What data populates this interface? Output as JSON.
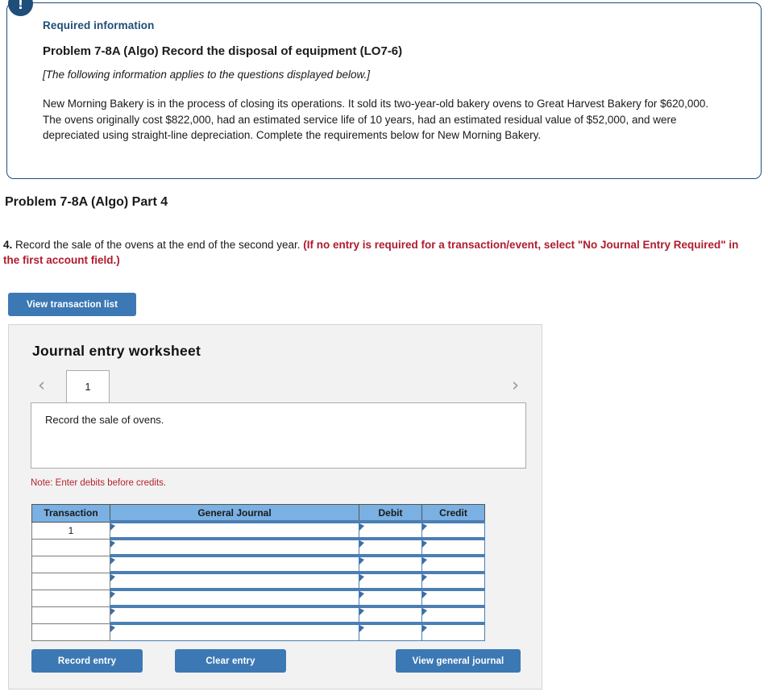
{
  "alert": {
    "icon": "exclamation-icon",
    "glyph": "!"
  },
  "info_box": {
    "required_label": "Required information",
    "problem_title": "Problem 7-8A (Algo) Record the disposal of equipment (LO7-6)",
    "applies_note": "[The following information applies to the questions displayed below.]",
    "body": "New Morning Bakery is in the process of closing its operations. It sold its two-year-old bakery ovens to Great Harvest Bakery for $620,000. The ovens originally cost $822,000, had an estimated service life of 10 years, had an estimated residual value of $52,000, and were depreciated using straight-line depreciation. Complete the requirements below for New Morning Bakery."
  },
  "part": {
    "heading": "Problem 7-8A (Algo) Part 4",
    "question_number": "4.",
    "question_text": " Record the sale of the ovens at the end of the second year. ",
    "question_red": "(If no entry is required for a transaction/event, select \"No Journal Entry Required\" in the first account field.)"
  },
  "buttons": {
    "view_transaction_list": "View transaction list",
    "record_entry": "Record entry",
    "clear_entry": "Clear entry",
    "view_general_journal": "View general journal"
  },
  "worksheet": {
    "title": "Journal entry worksheet",
    "prev_icon": "chevron-left-icon",
    "next_icon": "chevron-right-icon",
    "prev_glyph": "‹",
    "next_glyph": "›",
    "tabs": [
      {
        "label": "1",
        "active": true
      }
    ],
    "description": "Record the sale of ovens.",
    "note": "Note: Enter debits before credits.",
    "table": {
      "headers": [
        "Transaction",
        "General Journal",
        "Debit",
        "Credit"
      ],
      "rows": [
        {
          "transaction": "1",
          "general_journal": "",
          "debit": "",
          "credit": ""
        },
        {
          "transaction": "",
          "general_journal": "",
          "debit": "",
          "credit": ""
        },
        {
          "transaction": "",
          "general_journal": "",
          "debit": "",
          "credit": ""
        },
        {
          "transaction": "",
          "general_journal": "",
          "debit": "",
          "credit": ""
        },
        {
          "transaction": "",
          "general_journal": "",
          "debit": "",
          "credit": ""
        },
        {
          "transaction": "",
          "general_journal": "",
          "debit": "",
          "credit": ""
        },
        {
          "transaction": "",
          "general_journal": "",
          "debit": "",
          "credit": ""
        }
      ]
    }
  },
  "colors": {
    "accent_blue": "#3c78b4",
    "header_blue": "#7ab0e2",
    "navy": "#1f4e79",
    "red": "#b01c2e",
    "note_red": "#b5232e",
    "panel_gray": "#f2f2f2"
  }
}
